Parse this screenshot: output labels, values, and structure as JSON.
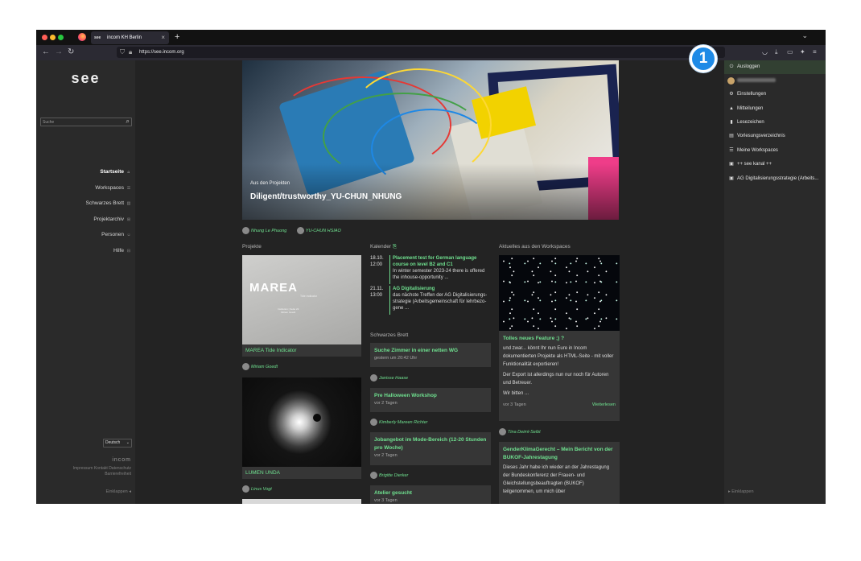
{
  "browser": {
    "tab_favicon": "see",
    "tab_title": "incom KH Berlin",
    "tab_close": "×",
    "new_tab": "+",
    "tab_list_chevron": "⌄",
    "url": "https://see.incom.org",
    "window_controls": {
      "close": "#ff5f57",
      "minimize": "#febc2e",
      "maximize": "#28c840"
    },
    "nav_icons": {
      "back": "back-arrow-icon",
      "forward": "forward-arrow-icon",
      "reload": "reload-icon"
    },
    "toolbar_icons": [
      "pocket-icon",
      "download-icon",
      "folder-icon",
      "extensions-icon",
      "menu-icon"
    ]
  },
  "sidebar": {
    "logo": "see",
    "search_placeholder": "Suche",
    "nav": [
      {
        "label": "Startseite",
        "icon": "house-icon",
        "active": true
      },
      {
        "label": "Workspaces",
        "icon": "list-icon",
        "active": false
      },
      {
        "label": "Schwarzes Brett",
        "icon": "board-icon",
        "active": false
      },
      {
        "label": "Projektarchiv",
        "icon": "grid-icon",
        "active": false
      },
      {
        "label": "Personen",
        "icon": "person-icon",
        "active": false
      },
      {
        "label": "Hilfe",
        "icon": "help-icon",
        "active": false
      }
    ],
    "language": "Deutsch",
    "brand": "incom",
    "footer_links": "Impressum Kontakt Datenschutz",
    "footer_links2": "Barrierefreiheit",
    "collapse": "Einklappen"
  },
  "hero": {
    "kicker": "Aus den Projekten",
    "title": "Diligent/trustworthy_YU-CHUN_NHUNG",
    "authors": [
      "Nhung Le Phuong",
      "YU-CHUN HSIAO"
    ]
  },
  "projects": {
    "heading": "Projekte",
    "items": [
      {
        "title": "MAREA Tide Indicator",
        "author": "Miriam Goedt",
        "cover_title": "MAREA",
        "cover_subtitle": "Tide Indicator",
        "cover_meta": "Institution | Seite 23",
        "cover_meta2": "Miriam Goedt"
      },
      {
        "title": "LUMEN UNDA",
        "author": "Linus Vogt"
      }
    ]
  },
  "calendar": {
    "heading": "Kalender",
    "events": [
      {
        "date": "18.10.",
        "time": "12:00",
        "title": "Placement test for German language course on level B2 and C1",
        "desc": "In winter semester 2023-24 there is offered the inhouse-opportunity ..."
      },
      {
        "date": "21.11.",
        "time": "13:00",
        "title": "AG Digitalisierung",
        "desc": "das nächste Treffen der AG Digitalisierungs-strategie (Arbeitsgemeinschaft für lehrbezo-gene ..."
      }
    ]
  },
  "board": {
    "heading": "Schwarzes Brett",
    "items": [
      {
        "title": "Suche Zimmer in einer netten WG",
        "date": "gestern um 20:42 Uhr",
        "author": "Janisse Haase"
      },
      {
        "title": "Pre Halloween Workshop",
        "date": "vor 2 Tagen",
        "author": "Kimberly Mareen Richter"
      },
      {
        "title": "Jobangebot im Mode-Bereich (12-20 Stunden pro Woche)",
        "date": "vor 2 Tagen",
        "author": "Brigitte Dierker"
      },
      {
        "title": "Atelier gesucht",
        "date": "vor 3 Tagen"
      }
    ]
  },
  "workspaces": {
    "heading": "Aktuelles aus den Workspaces",
    "posts": [
      {
        "title": "Tolles neues Feature ;) ?",
        "p1": "und zwar... könnt Ihr nun Eure in Incom dokumentierten Projekte als HTML-Seite - mit voller Funktionalität exportieren!",
        "p2": "Der Export ist allerdings nun nur noch für Autoren und Betreuer.",
        "p3": "Wir bitten ...",
        "date": "vor 3 Tagen",
        "more": "Weiterlesen",
        "author": "Tina Deiml-Seibt"
      },
      {
        "title": "GenderKlimaGerecht – Mein Bericht von der BUKOF-Jahrestagung",
        "p1": "Dieses Jahr habe ich wieder an der Jahrestagung der Bundeskonferenz der Frauen- und Gleichstellungsbeauftragten (BUKOF) teilgenommen, um mich über"
      }
    ]
  },
  "user_menu": {
    "items": [
      {
        "label": "Ausloggen",
        "icon": "power-icon"
      },
      {
        "label": "",
        "icon": "avatar"
      },
      {
        "label": "Einstellungen",
        "icon": "gear-icon"
      },
      {
        "label": "Mitteilungen",
        "icon": "bell-icon"
      },
      {
        "label": "Lesezeichen",
        "icon": "bookmark-icon"
      },
      {
        "label": "Vorlesungsverzeichnis",
        "icon": "book-icon"
      },
      {
        "label": "Meine Workspaces",
        "icon": "list-icon"
      },
      {
        "label": "++ see kanal ++",
        "icon": "channel-icon"
      },
      {
        "label": "AG Digitalisierungsstrategie (Arbeits...",
        "icon": "group-icon"
      }
    ],
    "collapse": "Einklappen"
  },
  "callout": {
    "number": "1",
    "color": "#1e8ae6"
  },
  "colors": {
    "accent": "#6fe08f",
    "background": "#232323",
    "card": "#363636"
  }
}
